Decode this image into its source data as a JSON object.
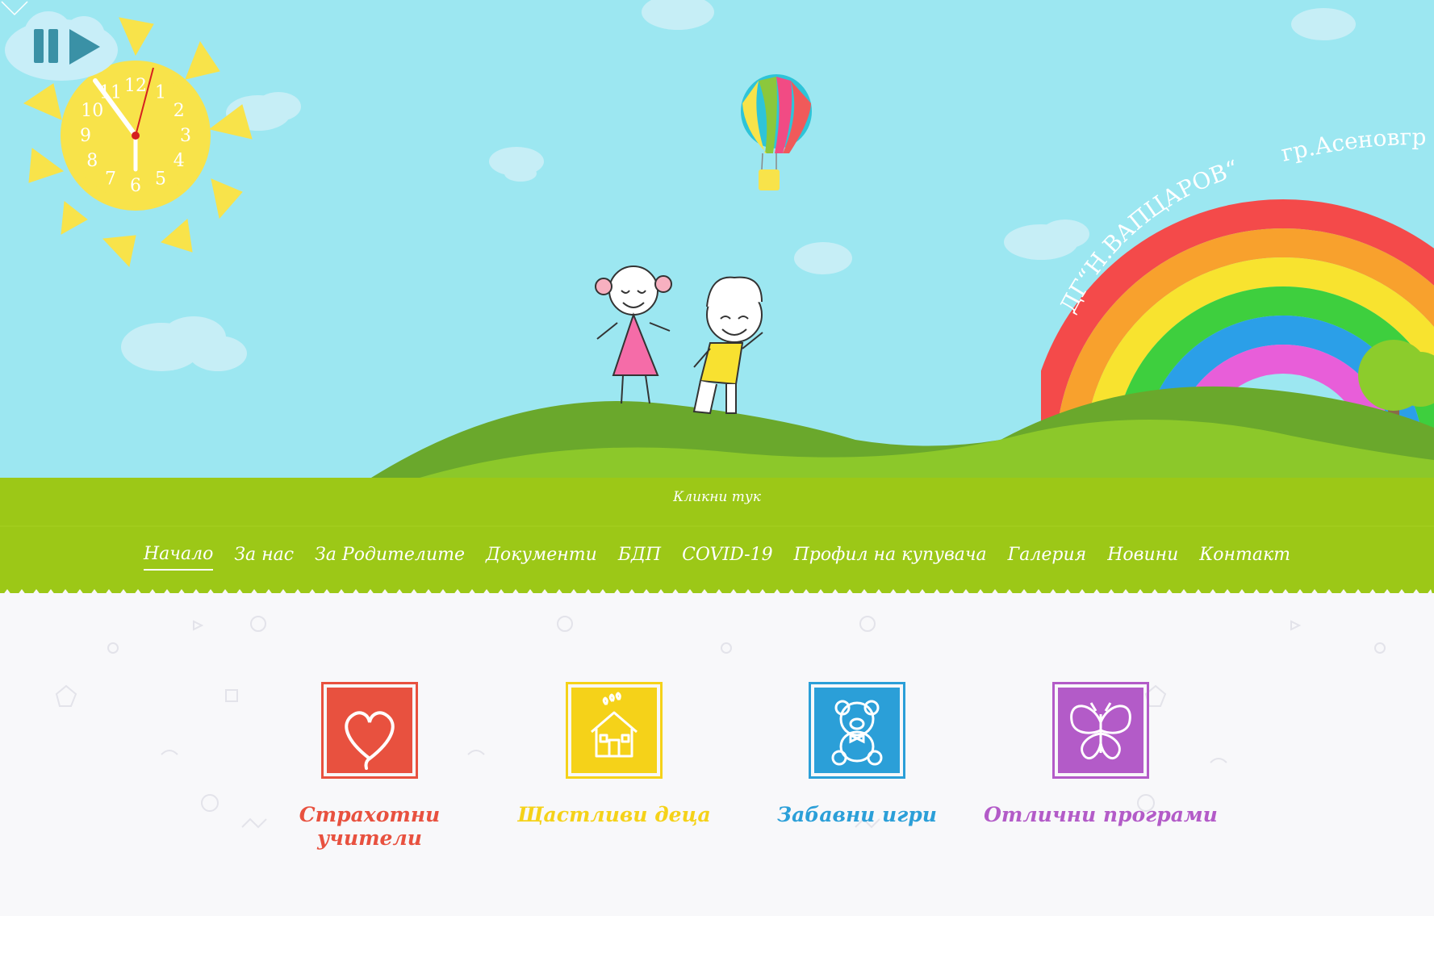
{
  "hero": {
    "kindergarten_name": "ДГ“Н.ВАПЦАРОВ“",
    "city": "гр.Асеновгр",
    "click_here": "Кликни тук",
    "clock_numbers": [
      "12",
      "1",
      "2",
      "3",
      "4",
      "5",
      "6",
      "7",
      "8",
      "9",
      "10",
      "11"
    ]
  },
  "nav": {
    "items": [
      {
        "label": "Начало",
        "active": true
      },
      {
        "label": "За нас"
      },
      {
        "label": "За Родителите"
      },
      {
        "label": "Документи"
      },
      {
        "label": "БДП"
      },
      {
        "label": "COVID-19"
      },
      {
        "label": "Профил на купувача"
      },
      {
        "label": "Галерия"
      },
      {
        "label": "Новини"
      },
      {
        "label": "Контакт"
      }
    ]
  },
  "features": [
    {
      "label": "Страхотни учители",
      "color": "#e8513f",
      "icon": "heart-icon"
    },
    {
      "label": "Щастливи деца",
      "color": "#f5d219",
      "icon": "house-icon"
    },
    {
      "label": "Забавни игри",
      "color": "#2b9fd8",
      "icon": "teddy-bear-icon"
    },
    {
      "label": "Отлични програми",
      "color": "#b35bc8",
      "icon": "butterfly-icon"
    }
  ],
  "colors": {
    "sky": "#9ce7f1",
    "grass": "#9cc817",
    "dark_grass": "#6aa82c",
    "sun": "#f8e34a"
  }
}
